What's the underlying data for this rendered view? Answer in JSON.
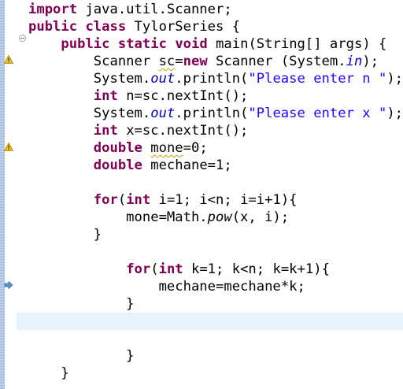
{
  "editor": {
    "lines": [
      [
        {
          "t": "import",
          "c": "kw"
        },
        {
          "t": " java.util.Scanner;"
        }
      ],
      [
        {
          "t": "public",
          "c": "kw"
        },
        {
          "t": " "
        },
        {
          "t": "class",
          "c": "kw"
        },
        {
          "t": " TylorSeries {"
        }
      ],
      [
        {
          "t": "    "
        },
        {
          "t": "public",
          "c": "kw"
        },
        {
          "t": " "
        },
        {
          "t": "static",
          "c": "kw"
        },
        {
          "t": " "
        },
        {
          "t": "void",
          "c": "kw"
        },
        {
          "t": " main(String[] args) {"
        }
      ],
      [
        {
          "t": "        Scanner "
        },
        {
          "t": "sc",
          "c": "squig"
        },
        {
          "t": "="
        },
        {
          "t": "new",
          "c": "kw"
        },
        {
          "t": " Scanner (System."
        },
        {
          "t": "in",
          "c": "field"
        },
        {
          "t": ");"
        }
      ],
      [
        {
          "t": "        System."
        },
        {
          "t": "out",
          "c": "field"
        },
        {
          "t": ".println("
        },
        {
          "t": "\"Please enter n \"",
          "c": "str"
        },
        {
          "t": ");"
        }
      ],
      [
        {
          "t": "        "
        },
        {
          "t": "int",
          "c": "kw"
        },
        {
          "t": " n=sc.nextInt();"
        }
      ],
      [
        {
          "t": "        System."
        },
        {
          "t": "out",
          "c": "field"
        },
        {
          "t": ".println("
        },
        {
          "t": "\"Please enter x \"",
          "c": "str"
        },
        {
          "t": ");"
        }
      ],
      [
        {
          "t": "        "
        },
        {
          "t": "int",
          "c": "kw"
        },
        {
          "t": " x=sc.nextInt();"
        }
      ],
      [
        {
          "t": "        "
        },
        {
          "t": "double",
          "c": "kw"
        },
        {
          "t": " "
        },
        {
          "t": "mone",
          "c": "squig"
        },
        {
          "t": "=0;"
        }
      ],
      [
        {
          "t": "        "
        },
        {
          "t": "double",
          "c": "kw"
        },
        {
          "t": " mechane=1;"
        }
      ],
      [
        {
          "t": ""
        }
      ],
      [
        {
          "t": "        "
        },
        {
          "t": "for",
          "c": "kw"
        },
        {
          "t": "("
        },
        {
          "t": "int",
          "c": "kw"
        },
        {
          "t": " i=1; i<n; i=i+1){"
        }
      ],
      [
        {
          "t": "            mone=Math."
        },
        {
          "t": "pow",
          "c": "mcall"
        },
        {
          "t": "(x, i);"
        }
      ],
      [
        {
          "t": "        }"
        }
      ],
      [
        {
          "t": ""
        }
      ],
      [
        {
          "t": "            "
        },
        {
          "t": "for",
          "c": "kw"
        },
        {
          "t": "("
        },
        {
          "t": "int",
          "c": "kw"
        },
        {
          "t": " k=1; k<n; k=k+1){"
        }
      ],
      [
        {
          "t": "                mechane=mechane*k;"
        }
      ],
      [
        {
          "t": "            }"
        }
      ],
      [
        {
          "t": ""
        }
      ],
      [
        {
          "t": ""
        }
      ],
      [
        {
          "t": "            }"
        }
      ],
      [
        {
          "t": "    }"
        }
      ]
    ]
  },
  "colors": {
    "keyword": "#7f0055",
    "string": "#2a00ff",
    "static_field": "#0000c0",
    "current_line": "#e8f2fe",
    "warning": "#e8b400"
  },
  "icons": [
    "fold-collapse-icon",
    "warning-icon",
    "warning-icon",
    "debug-arrow-icon"
  ]
}
